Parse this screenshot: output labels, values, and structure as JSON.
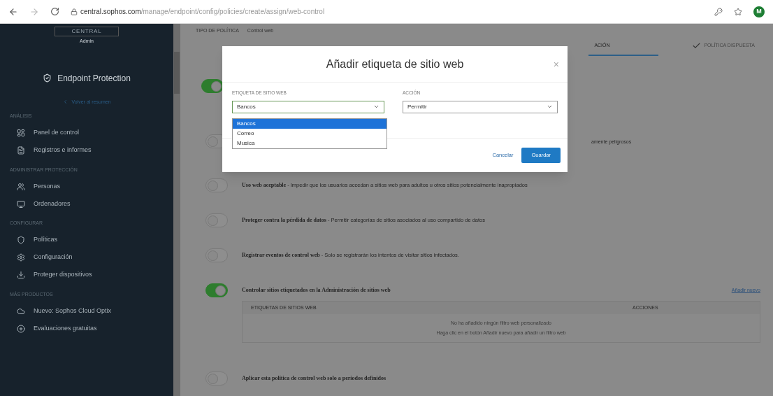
{
  "browser": {
    "url_host": "central.sophos.com",
    "url_path": "/manage/endpoint/config/policies/create/assign/web-control",
    "avatar": "M"
  },
  "sidebar": {
    "brand": "CENTRAL",
    "role": "Admin",
    "product": "Endpoint Protection",
    "back_link": "Volver al resumen",
    "sections": [
      {
        "title": "ANÁLISIS",
        "items": [
          {
            "label": "Panel de control"
          },
          {
            "label": "Registros e informes"
          }
        ]
      },
      {
        "title": "ADMINISTRAR PROTECCIÓN",
        "items": [
          {
            "label": "Personas"
          },
          {
            "label": "Ordenadores"
          }
        ]
      },
      {
        "title": "CONFIGURAR",
        "items": [
          {
            "label": "Políticas"
          },
          {
            "label": "Configuración"
          },
          {
            "label": "Proteger dispositivos"
          }
        ]
      },
      {
        "title": "MÁS PRODUCTOS",
        "items": [
          {
            "label": "Nuevo: Sophos Cloud Optix"
          },
          {
            "label": "Evaluaciones gratuitas"
          }
        ]
      }
    ]
  },
  "breadcrumb": {
    "label": "TIPO DE POLÍTICA",
    "value": "Control web"
  },
  "tabs": [
    {
      "label": "ACIÓN",
      "selected": true,
      "done": false
    },
    {
      "label": "POLÍTICA DISPUESTA",
      "selected": false,
      "done": true
    }
  ],
  "settings": [
    {
      "kind": "covered",
      "on": true
    },
    {
      "kind": "clipped",
      "on": false,
      "text": "amente peligrosos"
    },
    {
      "kind": "full",
      "on": false,
      "title": "Uso web aceptable",
      "text": "- Impedir que los usuarios accedan a sitios web para adultos u otros sitios potencialmente inapropiados"
    },
    {
      "kind": "full",
      "on": false,
      "title": "Proteger contra la pérdida de datos",
      "text": "- Permitir categorías de sitios asociados al uso compartido de datos"
    },
    {
      "kind": "full",
      "on": false,
      "title": "Registrar eventos de control web",
      "text": "- Solo se registrarán los intentos de visitar sitios infectados."
    },
    {
      "kind": "table",
      "on": true,
      "title": "Controlar sitios etiquetados en la Administración de sitios web",
      "link": "Añadir nuevo",
      "columns": [
        "ETIQUETAS DE SITIOS WEB",
        "ACCIONES"
      ],
      "empty": [
        "No ha añadido ningún filtro web personalizado",
        "Haga clic en el botón Añadir nuevo para añadir un filtro web"
      ]
    },
    {
      "kind": "full",
      "on": false,
      "title": "Aplicar esta política de control web solo a periodos definidos"
    }
  ],
  "dialog": {
    "title": "Añadir etiqueta de sitio web",
    "close": "×",
    "tag_field": {
      "label": "ETIQUETA DE SITIO WEB",
      "value": "Bancos",
      "options": [
        {
          "label": "Bancos",
          "selected": true
        },
        {
          "label": "Correo",
          "selected": false
        },
        {
          "label": "Musica",
          "selected": false
        }
      ]
    },
    "action_field": {
      "label": "ACCIÓN",
      "value": "Permitir"
    },
    "buttons": [
      {
        "label": "Cancelar",
        "kind": "link"
      },
      {
        "label": "Guardar",
        "kind": "primary"
      }
    ]
  }
}
